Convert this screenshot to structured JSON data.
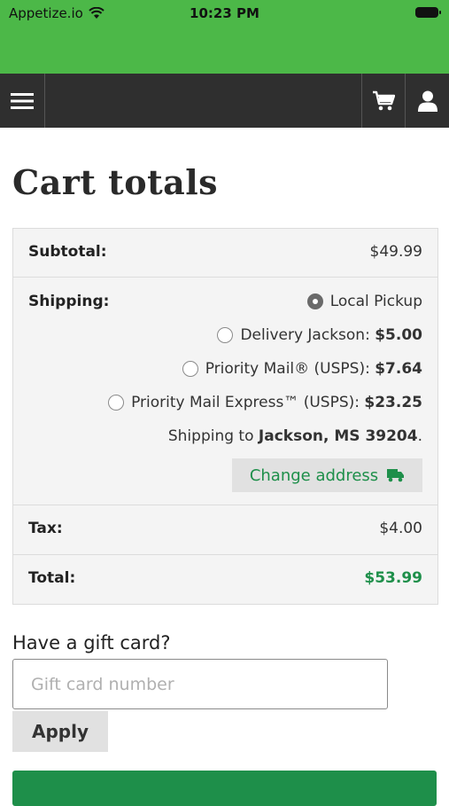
{
  "status_bar": {
    "carrier": "Appetize.io",
    "time": "10:23 PM"
  },
  "nav": {
    "menu_icon": "hamburger-menu-icon",
    "cart_icon": "cart-icon",
    "user_icon": "user-icon"
  },
  "page": {
    "title": "Cart totals"
  },
  "totals": {
    "subtotal_label": "Subtotal:",
    "subtotal_value": "$49.99",
    "shipping_label": "Shipping:",
    "shipping_options": [
      {
        "label": "Local Pickup",
        "price": "",
        "selected": true
      },
      {
        "label": "Delivery Jackson: ",
        "price": "$5.00",
        "selected": false
      },
      {
        "label": "Priority Mail® (USPS): ",
        "price": "$7.64",
        "selected": false
      },
      {
        "label": "Priority Mail Express™ (USPS): ",
        "price": "$23.25",
        "selected": false
      }
    ],
    "shipping_to_prefix": "Shipping to ",
    "shipping_to_location": "Jackson, MS 39204",
    "shipping_to_suffix": ".",
    "change_address_label": "Change address",
    "tax_label": "Tax:",
    "tax_value": "$4.00",
    "total_label": "Total:",
    "total_value": "$53.99"
  },
  "gift_card": {
    "heading": "Have a gift card?",
    "placeholder": "Gift card number",
    "value": "",
    "apply_label": "Apply"
  },
  "colors": {
    "status_green": "#4cb848",
    "nav_dark": "#2f2f2f",
    "accent_green": "#1e8f4a"
  }
}
